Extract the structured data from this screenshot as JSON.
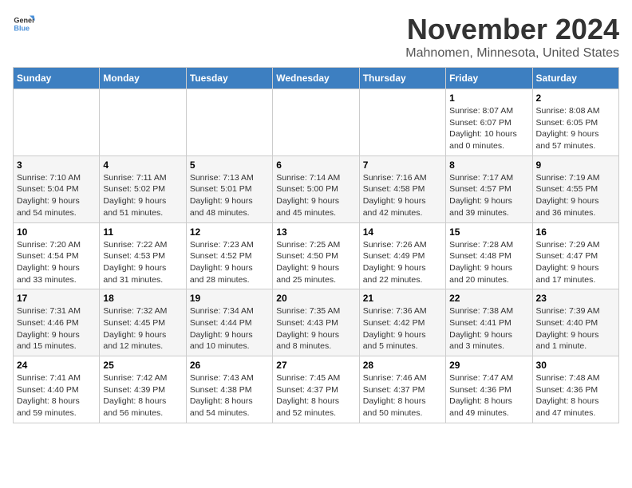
{
  "logo": {
    "line1": "General",
    "line2": "Blue"
  },
  "title": "November 2024",
  "location": "Mahnomen, Minnesota, United States",
  "weekdays": [
    "Sunday",
    "Monday",
    "Tuesday",
    "Wednesday",
    "Thursday",
    "Friday",
    "Saturday"
  ],
  "weeks": [
    [
      {
        "day": "",
        "info": ""
      },
      {
        "day": "",
        "info": ""
      },
      {
        "day": "",
        "info": ""
      },
      {
        "day": "",
        "info": ""
      },
      {
        "day": "",
        "info": ""
      },
      {
        "day": "1",
        "info": "Sunrise: 8:07 AM\nSunset: 6:07 PM\nDaylight: 10 hours\nand 0 minutes."
      },
      {
        "day": "2",
        "info": "Sunrise: 8:08 AM\nSunset: 6:05 PM\nDaylight: 9 hours\nand 57 minutes."
      }
    ],
    [
      {
        "day": "3",
        "info": "Sunrise: 7:10 AM\nSunset: 5:04 PM\nDaylight: 9 hours\nand 54 minutes."
      },
      {
        "day": "4",
        "info": "Sunrise: 7:11 AM\nSunset: 5:02 PM\nDaylight: 9 hours\nand 51 minutes."
      },
      {
        "day": "5",
        "info": "Sunrise: 7:13 AM\nSunset: 5:01 PM\nDaylight: 9 hours\nand 48 minutes."
      },
      {
        "day": "6",
        "info": "Sunrise: 7:14 AM\nSunset: 5:00 PM\nDaylight: 9 hours\nand 45 minutes."
      },
      {
        "day": "7",
        "info": "Sunrise: 7:16 AM\nSunset: 4:58 PM\nDaylight: 9 hours\nand 42 minutes."
      },
      {
        "day": "8",
        "info": "Sunrise: 7:17 AM\nSunset: 4:57 PM\nDaylight: 9 hours\nand 39 minutes."
      },
      {
        "day": "9",
        "info": "Sunrise: 7:19 AM\nSunset: 4:55 PM\nDaylight: 9 hours\nand 36 minutes."
      }
    ],
    [
      {
        "day": "10",
        "info": "Sunrise: 7:20 AM\nSunset: 4:54 PM\nDaylight: 9 hours\nand 33 minutes."
      },
      {
        "day": "11",
        "info": "Sunrise: 7:22 AM\nSunset: 4:53 PM\nDaylight: 9 hours\nand 31 minutes."
      },
      {
        "day": "12",
        "info": "Sunrise: 7:23 AM\nSunset: 4:52 PM\nDaylight: 9 hours\nand 28 minutes."
      },
      {
        "day": "13",
        "info": "Sunrise: 7:25 AM\nSunset: 4:50 PM\nDaylight: 9 hours\nand 25 minutes."
      },
      {
        "day": "14",
        "info": "Sunrise: 7:26 AM\nSunset: 4:49 PM\nDaylight: 9 hours\nand 22 minutes."
      },
      {
        "day": "15",
        "info": "Sunrise: 7:28 AM\nSunset: 4:48 PM\nDaylight: 9 hours\nand 20 minutes."
      },
      {
        "day": "16",
        "info": "Sunrise: 7:29 AM\nSunset: 4:47 PM\nDaylight: 9 hours\nand 17 minutes."
      }
    ],
    [
      {
        "day": "17",
        "info": "Sunrise: 7:31 AM\nSunset: 4:46 PM\nDaylight: 9 hours\nand 15 minutes."
      },
      {
        "day": "18",
        "info": "Sunrise: 7:32 AM\nSunset: 4:45 PM\nDaylight: 9 hours\nand 12 minutes."
      },
      {
        "day": "19",
        "info": "Sunrise: 7:34 AM\nSunset: 4:44 PM\nDaylight: 9 hours\nand 10 minutes."
      },
      {
        "day": "20",
        "info": "Sunrise: 7:35 AM\nSunset: 4:43 PM\nDaylight: 9 hours\nand 8 minutes."
      },
      {
        "day": "21",
        "info": "Sunrise: 7:36 AM\nSunset: 4:42 PM\nDaylight: 9 hours\nand 5 minutes."
      },
      {
        "day": "22",
        "info": "Sunrise: 7:38 AM\nSunset: 4:41 PM\nDaylight: 9 hours\nand 3 minutes."
      },
      {
        "day": "23",
        "info": "Sunrise: 7:39 AM\nSunset: 4:40 PM\nDaylight: 9 hours\nand 1 minute."
      }
    ],
    [
      {
        "day": "24",
        "info": "Sunrise: 7:41 AM\nSunset: 4:40 PM\nDaylight: 8 hours\nand 59 minutes."
      },
      {
        "day": "25",
        "info": "Sunrise: 7:42 AM\nSunset: 4:39 PM\nDaylight: 8 hours\nand 56 minutes."
      },
      {
        "day": "26",
        "info": "Sunrise: 7:43 AM\nSunset: 4:38 PM\nDaylight: 8 hours\nand 54 minutes."
      },
      {
        "day": "27",
        "info": "Sunrise: 7:45 AM\nSunset: 4:37 PM\nDaylight: 8 hours\nand 52 minutes."
      },
      {
        "day": "28",
        "info": "Sunrise: 7:46 AM\nSunset: 4:37 PM\nDaylight: 8 hours\nand 50 minutes."
      },
      {
        "day": "29",
        "info": "Sunrise: 7:47 AM\nSunset: 4:36 PM\nDaylight: 8 hours\nand 49 minutes."
      },
      {
        "day": "30",
        "info": "Sunrise: 7:48 AM\nSunset: 4:36 PM\nDaylight: 8 hours\nand 47 minutes."
      }
    ]
  ]
}
